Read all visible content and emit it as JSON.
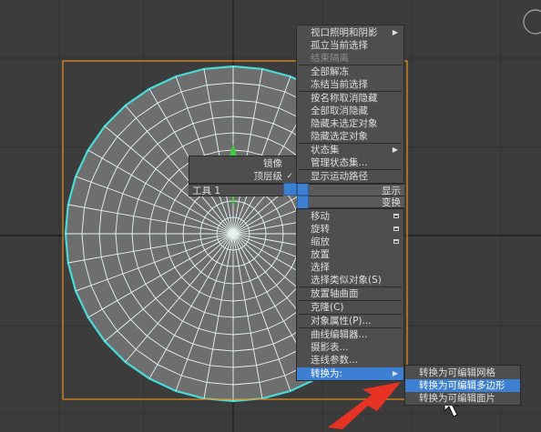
{
  "colors": {
    "viewport_bg": "#3c3c3c",
    "menu_bg": "#4e4e4e",
    "highlight": "#3c7fd3",
    "wire": "#e6f4f4",
    "outline": "#47dcd8",
    "selection_box": "#e8901e",
    "arrow": "#e63323"
  },
  "left_menu": {
    "mirror": "镜像",
    "top_level": "顶层级",
    "top_level_check": "✓",
    "tools1": "工具 1"
  },
  "quad_labels": {
    "display": "显示",
    "transform": "变换"
  },
  "display_menu": [
    {
      "label": "视口照明和阴影",
      "submenu": true
    },
    {
      "label": "孤立当前选择"
    },
    {
      "label": "结束隔离",
      "disabled": true
    },
    {
      "label": "全部解冻"
    },
    {
      "label": "冻结当前选择"
    },
    {
      "label": "按名称取消隐藏"
    },
    {
      "label": "全部取消隐藏"
    },
    {
      "label": "隐藏未选定对象"
    },
    {
      "label": "隐藏选定对象"
    },
    {
      "label": "状态集",
      "submenu": true
    },
    {
      "label": "管理状态集..."
    },
    {
      "label": "显示运动路径"
    }
  ],
  "transform_menu": [
    {
      "label": "移动",
      "box": true
    },
    {
      "label": "旋转",
      "box": true
    },
    {
      "label": "缩放",
      "box": true
    },
    {
      "label": "放置"
    },
    {
      "label": "选择"
    },
    {
      "label": "选择类似对象(S)"
    },
    {
      "label": "放置轴曲面"
    },
    {
      "label": "克隆(C)"
    },
    {
      "label": "对象属性(P)..."
    },
    {
      "label": "曲线编辑器..."
    },
    {
      "label": "摄影表..."
    },
    {
      "label": "连线参数..."
    },
    {
      "label": "转换为:",
      "submenu": true,
      "highlighted": true
    }
  ],
  "convert_submenu": [
    {
      "label": "转换为可编辑网格"
    },
    {
      "label": "转换为可编辑多边形",
      "highlighted": true
    },
    {
      "label": "转换为可编辑面片"
    }
  ],
  "icons": {
    "submenu_arrow": "▶",
    "viewcube": "viewcube-icon",
    "cursor": "mouse-cursor-icon"
  }
}
